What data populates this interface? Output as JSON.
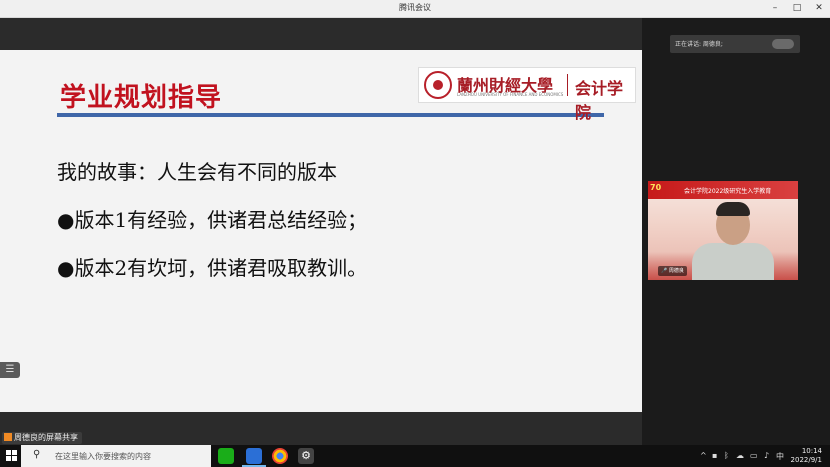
{
  "window": {
    "title": "腾讯会议",
    "controls": {
      "minimize": "–",
      "maximize": "□",
      "close": "✕"
    }
  },
  "slide": {
    "title": "学业规划指导",
    "logo": {
      "university": "蘭州財經大學",
      "university_sub": "LANZHOU UNIVERSITY OF FINANCE AND ECONOMICS",
      "school": "会计学院"
    },
    "lines": [
      "我的故事：人生会有不同的版本",
      "●版本1有经验，供诸君总结经验；",
      "●版本2有坎坷，供诸君吸取教训。"
    ]
  },
  "side_button": {
    "icon": "list-icon",
    "glyph": "☰"
  },
  "speaking": {
    "label": "正在讲话: 周德良;"
  },
  "video": {
    "badge": "70",
    "banner": "会计学院2022级研究生入学教育",
    "name": "周德良"
  },
  "share_label": "周德良的屏幕共享",
  "taskbar": {
    "search_placeholder": "在这里输入你要搜索的内容",
    "tray_lang": "中",
    "time": "10:14",
    "date": "2022/9/1"
  },
  "colors": {
    "slide_title": "#c1121f",
    "slide_line": "#3f66a8",
    "accent": "#a71d26"
  }
}
